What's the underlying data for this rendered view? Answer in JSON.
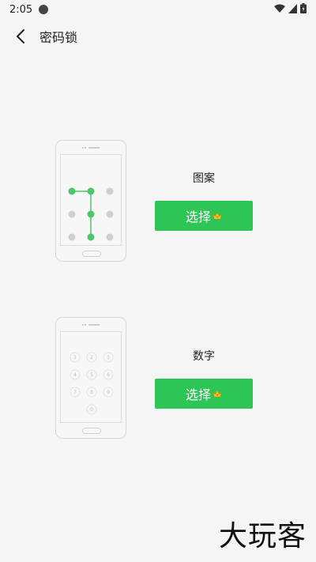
{
  "status_bar": {
    "time": "2:05"
  },
  "header": {
    "title": "密码锁"
  },
  "options": [
    {
      "label": "图案",
      "button_label": "选择"
    },
    {
      "label": "数字",
      "button_label": "选择"
    }
  ],
  "keypad_digits": [
    "1",
    "2",
    "3",
    "4",
    "5",
    "6",
    "7",
    "8",
    "9",
    "0"
  ],
  "watermark": "大玩客",
  "colors": {
    "accent": "#2dc556",
    "pattern_active": "#4cc66a",
    "pattern_inactive": "#cfcfcf"
  },
  "icons": {
    "back": "chevron-left-icon",
    "crown": "crown-icon"
  }
}
